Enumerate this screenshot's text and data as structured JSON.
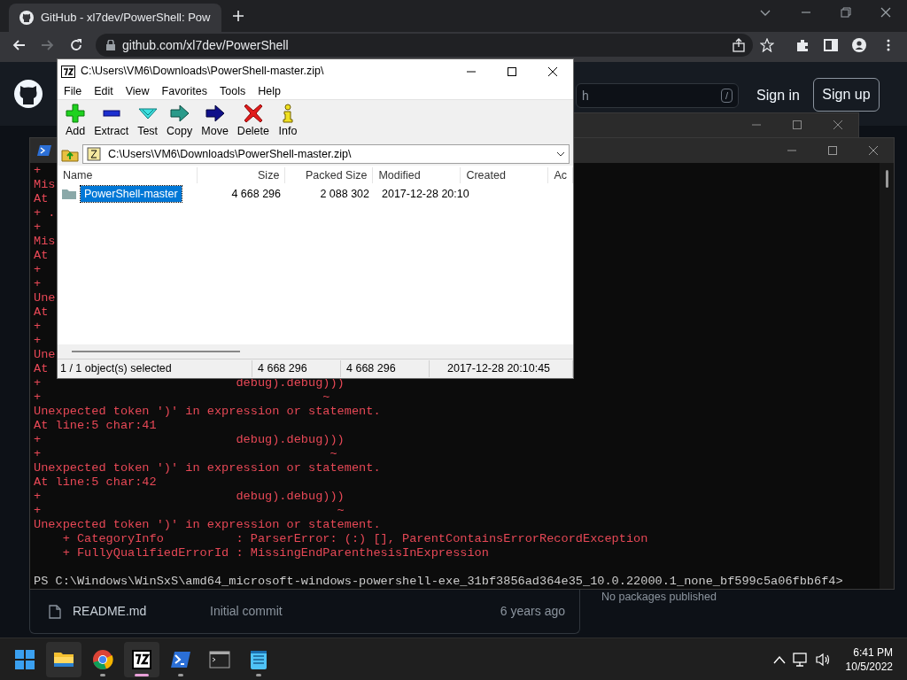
{
  "browser": {
    "tab_title": "GitHub - xl7dev/PowerShell: Pow",
    "address": "github.com/xl7dev/PowerShell",
    "forward_disabled": true
  },
  "github": {
    "search_placeholder": "h",
    "search_key": "/",
    "sign_in": "Sign in",
    "sign_up": "Sign up",
    "files": [
      {
        "name": "README.md",
        "commit": "Initial commit",
        "age": "6 years ago"
      }
    ],
    "packages": "No packages published"
  },
  "powershell": {
    "lines": [
      "+",
      "Mis",
      "At",
      "+ .",
      "+",
      "Mis",
      "At",
      "+",
      "+",
      "Une",
      "At",
      "+",
      "+",
      "Une",
      "At",
      "+                           debug).debug)))",
      "+                                       ~",
      "Unexpected token ')' in expression or statement.",
      "At line:5 char:41",
      "+                           debug).debug)))",
      "+                                        ~",
      "Unexpected token ')' in expression or statement.",
      "At line:5 char:42",
      "+                           debug).debug)))",
      "+                                         ~",
      "Unexpected token ')' in expression or statement.",
      "    + CategoryInfo          : ParserError: (:) [], ParentContainsErrorRecordException",
      "    + FullyQualifiedErrorId : MissingEndParenthesisInExpression"
    ],
    "prompt": "PS C:\\Windows\\WinSxS\\amd64_microsoft-windows-powershell-exe_31bf3856ad364e35_10.0.22000.1_none_bf599c5a06fbb6f4>"
  },
  "archiver": {
    "title": "C:\\Users\\VM6\\Downloads\\PowerShell-master.zip\\",
    "menu": [
      "File",
      "Edit",
      "View",
      "Favorites",
      "Tools",
      "Help"
    ],
    "toolbar": [
      {
        "label": "Add",
        "kind": "add"
      },
      {
        "label": "Extract",
        "kind": "extract"
      },
      {
        "label": "Test",
        "kind": "test"
      },
      {
        "label": "Copy",
        "kind": "copy"
      },
      {
        "label": "Move",
        "kind": "move"
      },
      {
        "label": "Delete",
        "kind": "delete"
      },
      {
        "label": "Info",
        "kind": "info"
      }
    ],
    "path": "C:\\Users\\VM6\\Downloads\\PowerShell-master.zip\\",
    "columns": [
      "Name",
      "Size",
      "Packed Size",
      "Modified",
      "Created",
      "Ac"
    ],
    "rows": [
      {
        "name": "PowerShell-master",
        "size": "4 668 296",
        "packed": "2 088 302",
        "modified": "2017-12-28 20:10",
        "selected": true
      }
    ],
    "status": [
      "1 / 1 object(s) selected",
      "4 668 296",
      "4 668 296",
      "2017-12-28 20:10:45"
    ]
  },
  "taskbar": {
    "apps": [
      {
        "kind": "explorer",
        "running": false,
        "active": false,
        "highlighted": true
      },
      {
        "kind": "chrome",
        "running": true,
        "active": false,
        "highlighted": false
      },
      {
        "kind": "sevenzip",
        "running": true,
        "active": true,
        "highlighted": true
      },
      {
        "kind": "powershell",
        "running": true,
        "active": false,
        "highlighted": false
      },
      {
        "kind": "terminal",
        "running": false,
        "active": false,
        "highlighted": false
      },
      {
        "kind": "notepad",
        "running": true,
        "active": false,
        "highlighted": false
      }
    ],
    "time": "6:41 PM",
    "date": "10/5/2022"
  }
}
